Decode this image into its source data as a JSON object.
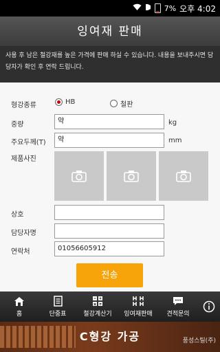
{
  "status_bar": {
    "battery": "7%",
    "time": "오후 4:02"
  },
  "header": {
    "title": "잉여재 판매"
  },
  "notice": {
    "text": "사용 후 남은 철강재를 높은 가격에 판매 하실 수 있습니다. 내용을 보내주시면 담당자가 확인 후 연락 드립니다."
  },
  "form": {
    "steel_type_label": "형강종류",
    "steel_type_options": [
      "HB",
      "철판"
    ],
    "steel_type_selected": "HB",
    "weight_label": "중량",
    "weight_value": "약",
    "weight_unit": "kg",
    "thickness_label": "주요두께(T)",
    "thickness_value": "약",
    "thickness_unit": "mm",
    "photo_label": "제품사진",
    "company_label": "상호",
    "company_value": "",
    "manager_label": "담당자명",
    "manager_value": "",
    "contact_label": "연락처",
    "contact_value": "01056605912",
    "submit_label": "전송"
  },
  "tabbar": {
    "items": [
      {
        "label": "홈",
        "icon": "home-icon"
      },
      {
        "label": "단중표",
        "icon": "document-icon"
      },
      {
        "label": "철강계산기",
        "icon": "calculator-icon"
      },
      {
        "label": "잉여재판매",
        "icon": "h-beam-icon"
      },
      {
        "label": "견적문의",
        "icon": "chat-icon"
      }
    ]
  },
  "banner": {
    "title": "C형강 가공",
    "company": "풍성스틸(주)"
  }
}
